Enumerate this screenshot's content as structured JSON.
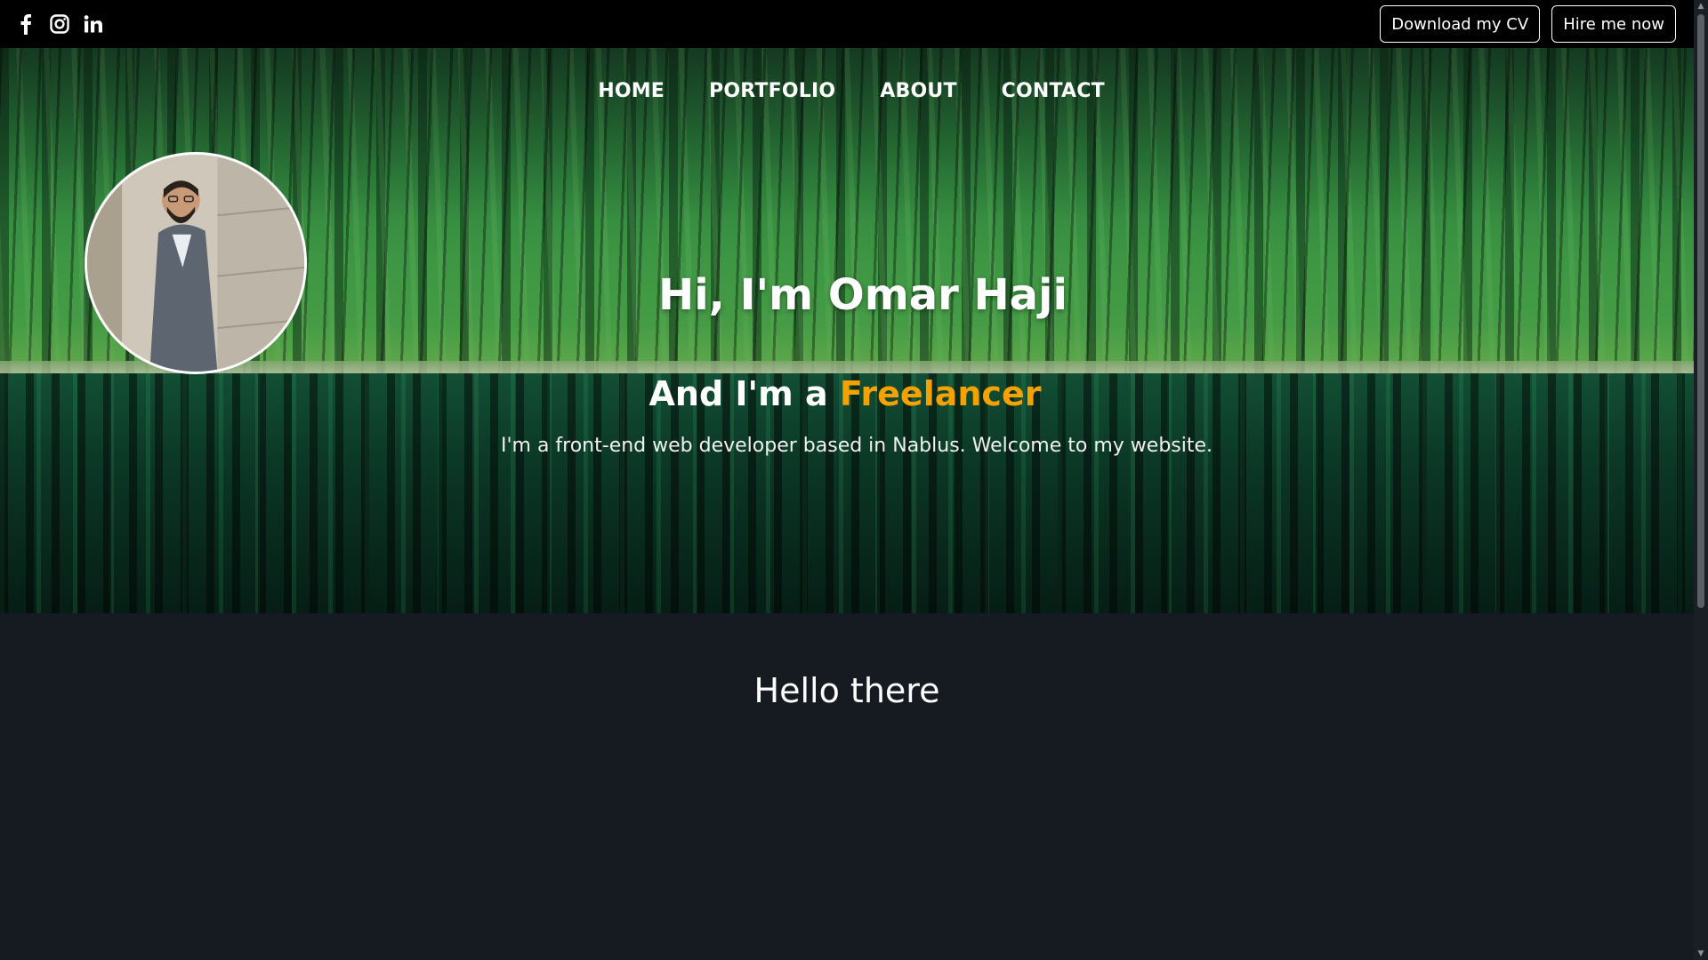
{
  "social": {
    "facebook": "facebook-icon",
    "instagram": "instagram-icon",
    "linkedin": "linkedin-icon"
  },
  "top_actions": {
    "download_cv": "Download my CV",
    "hire": "Hire me now"
  },
  "nav": {
    "items": [
      "HOME",
      "PORTFOLIO",
      "ABOUT",
      "CONTACT"
    ]
  },
  "hero": {
    "title": "Hi, I'm Omar Haji",
    "subtitle_prefix": "And I'm a ",
    "subtitle_role": "Freelancer",
    "description": "I'm a front-end web developer based in Nablus. Welcome to my website."
  },
  "section": {
    "heading": "Hello there"
  },
  "colors": {
    "accent": "#f5a200",
    "topbar_bg": "#000000",
    "page_bg": "#161b22"
  }
}
